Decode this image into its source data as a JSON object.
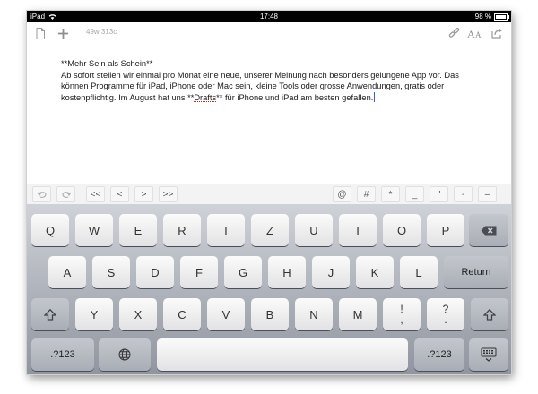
{
  "status_bar": {
    "device": "iPad",
    "time": "17:48",
    "battery": "98 %",
    "battery_level": 0.98
  },
  "toolbar": {
    "char_count": "49w 313c"
  },
  "document": {
    "title_line": "**Mehr Sein als Schein**",
    "body_before": "Ab sofort stellen wir einmal pro Monat eine neue, unserer Meinung nach besonders gelungene App vor. Das können Programme für iPad, iPhone oder Mac sein, kleine Tools oder grosse Anwendungen, gratis oder kostenpflichtig. Im August hat uns **",
    "misspelled_word": "Drafts",
    "body_after": "** für iPhone und iPad am besten gefallen."
  },
  "accessory_bar": {
    "nav_keys": [
      "<<",
      "<",
      ">",
      ">>"
    ],
    "symbol_keys": [
      "@",
      "#",
      "*",
      "_",
      "\"",
      "-",
      "–"
    ]
  },
  "keyboard": {
    "row1": [
      "Q",
      "W",
      "E",
      "R",
      "T",
      "Z",
      "U",
      "I",
      "O",
      "P"
    ],
    "row2": [
      "A",
      "S",
      "D",
      "F",
      "G",
      "H",
      "J",
      "K",
      "L"
    ],
    "row3": [
      "Y",
      "X",
      "C",
      "V",
      "B",
      "N",
      "M"
    ],
    "return_label": "Return",
    "numbers_label": ".?123",
    "punct1": {
      "top": "!",
      "bottom": ","
    },
    "punct2": {
      "top": "?",
      "bottom": "."
    }
  }
}
